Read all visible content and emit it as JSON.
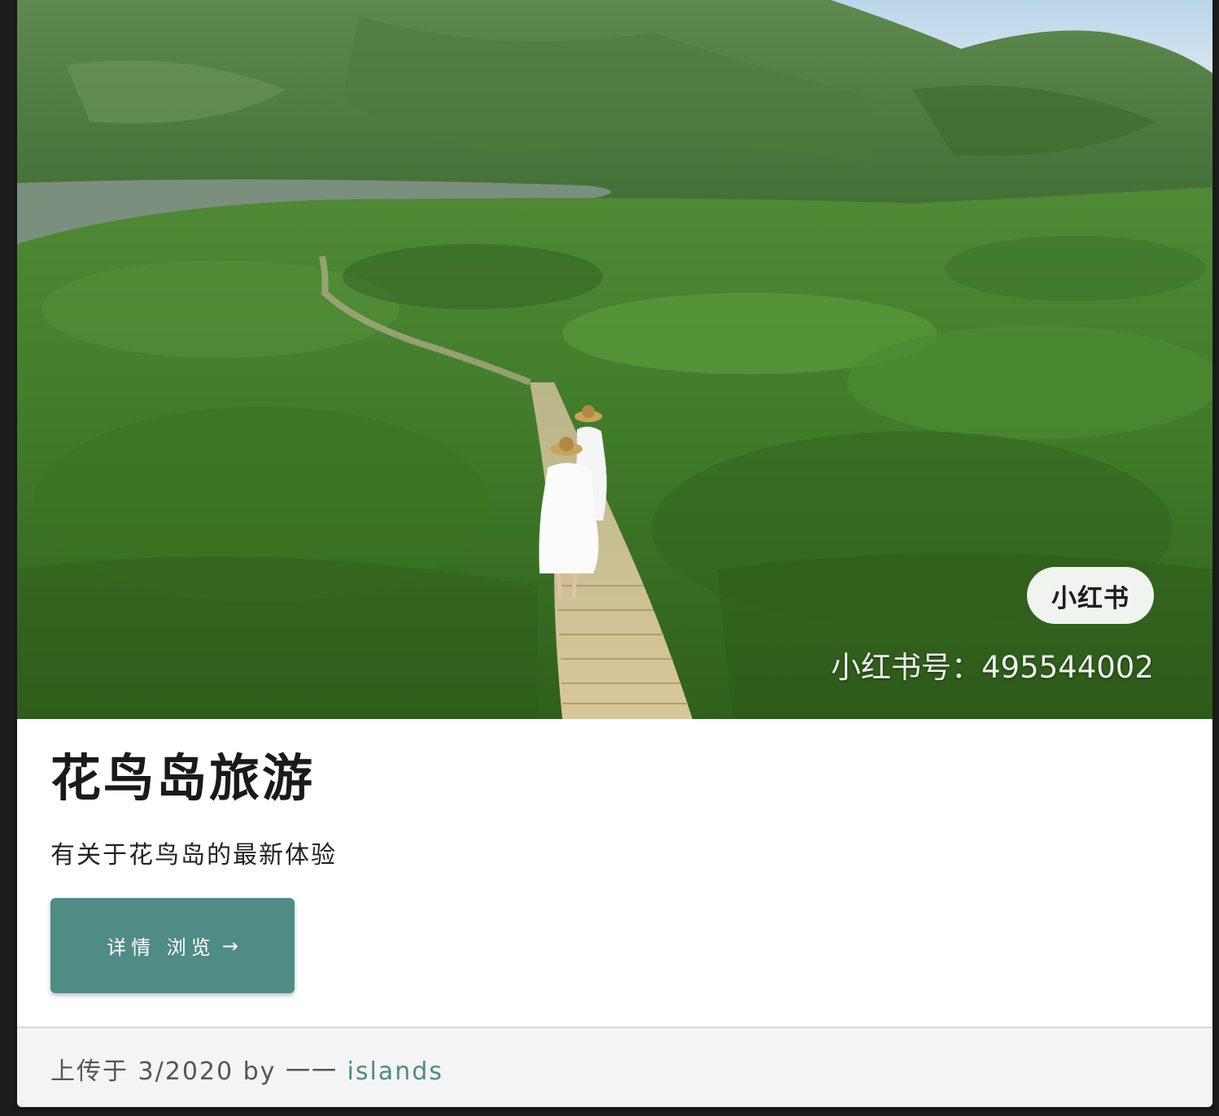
{
  "card": {
    "image_alt": "",
    "watermark_badge": "小红书",
    "watermark_id": "小红书号：495544002",
    "title": "花鸟岛旅游",
    "subtitle": "有关于花鸟岛的最新体验",
    "cta_label": "详情 浏览",
    "cta_icon": "arrow-right-icon",
    "footer": {
      "prefix": "上传于 3/2020 by 一一",
      "author": "islands"
    }
  },
  "colors": {
    "accent": "#4e8c84",
    "page_background": "#1c1c1c",
    "footer_background": "#f4f4f4"
  }
}
